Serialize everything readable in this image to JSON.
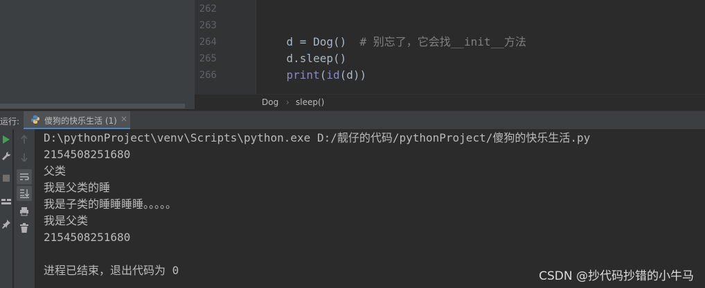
{
  "editor": {
    "line_numbers": [
      "262",
      "263",
      "264",
      "265",
      "266"
    ],
    "code_lines": [
      {
        "code": "",
        "comment": ""
      },
      {
        "code": "d = Dog()  ",
        "comment": "# 别忘了，它会找__init__方法"
      },
      {
        "code": "d.sleep()",
        "comment": ""
      },
      {
        "builtin1": "print",
        "p1": "(",
        "builtin2": "id",
        "rest": "(d))"
      },
      {
        "code": "",
        "comment": ""
      }
    ],
    "breadcrumb": [
      "Dog",
      "›",
      "sleep()"
    ]
  },
  "run_panel": {
    "title": "运行:",
    "tab_label": "傻狗的快乐生活 (1)",
    "tab_close": "×"
  },
  "console": {
    "lines": [
      "D:\\pythonProject\\venv\\Scripts\\python.exe D:/靓仔的代码/pythonProject/傻狗的快乐生活.py",
      "2154508251680",
      "父类",
      "我是父类的睡",
      "我是子类的睡睡睡睡。。。。。",
      "我是父类",
      "2154508251680",
      "",
      "进程已结束，退出代码为 0"
    ]
  },
  "watermark": "CSDN @抄代码抄错的小牛马",
  "colors": {
    "editor_bg": "#2b2b2b",
    "panel_bg": "#3c3f41",
    "run_green": "#499c54",
    "comment": "#808080",
    "builtin": "#8888c6"
  }
}
